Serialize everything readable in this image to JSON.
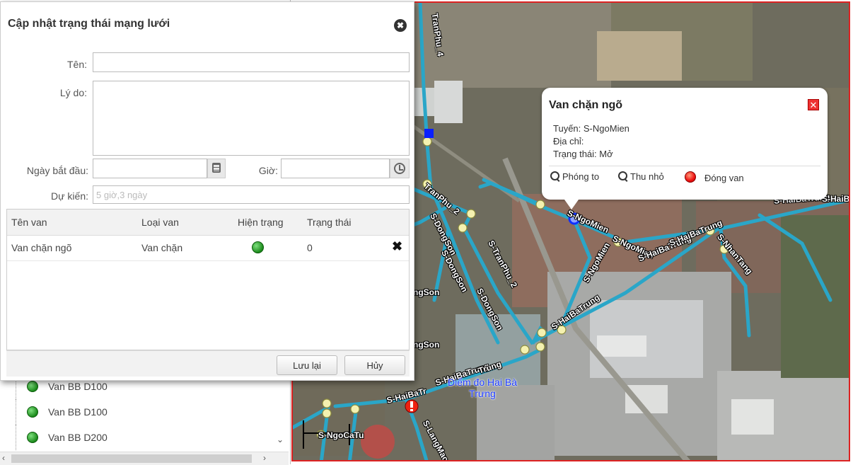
{
  "dialog": {
    "title": "Cập nhật trạng thái mạng lưới",
    "close_symbol": "✖",
    "fields": {
      "name_label": "Tên:",
      "name_value": "",
      "reason_label": "Lý do:",
      "reason_value": "",
      "start_date_label": "Ngày bắt đầu:",
      "start_date_value": "",
      "time_label": "Giờ:",
      "time_value": "",
      "expected_label": "Dự kiến:",
      "expected_placeholder": "5 giờ,3 ngày"
    },
    "table": {
      "headers": [
        "Tên van",
        "Loại van",
        "Hiện trạng",
        "Trạng thái"
      ],
      "rows": [
        {
          "name": "Van chặn ngõ",
          "type": "Van chặn",
          "current_state_icon": "green-dot-icon",
          "status": "0",
          "delete_symbol": "✖"
        }
      ]
    },
    "buttons": {
      "save": "Lưu lại",
      "cancel": "Hủy"
    }
  },
  "left_panel": {
    "valve_list": [
      "Van BB D100",
      "Van BB D100",
      "Van BB D200"
    ],
    "scroll_down": "⌄",
    "scroll_left": "‹",
    "scroll_right": "›"
  },
  "map": {
    "popup": {
      "title": "Van chặn ngõ",
      "close_symbol": "✕",
      "route_label": "Tuyến:",
      "route_value": "S-NgoMien",
      "address_label": "Địa chỉ:",
      "address_value": "",
      "status_label": "Trạng thái:",
      "status_value": "Mở",
      "zoom_in": "Phóng to",
      "zoom_out": "Thu nhỏ",
      "close_valve": "Đóng van"
    },
    "place_label": "Điểm đo Hai Bà Trưng",
    "road_labels": [
      "TranPhu_4",
      "TranPhu_2",
      "S-DongSon",
      "S-DongSon",
      "S-DongSon",
      "S-TranPhu_2",
      "S-NgoMien",
      "S-NgoMien",
      "S-NgoMien",
      "S-HaiBaTrung",
      "S-HaiBaTrung",
      "S-NhanTang",
      "S-HaiBaTrung",
      "S-HaiBa",
      "ngSon",
      "ngSon",
      "S-HaiBaTrung",
      "S-HaiBaTr",
      "S-LangMac",
      "S-NgoCaTu",
      "Trung",
      "S-HaiBaTrung"
    ],
    "colors": {
      "pipe": "#2aa6c8",
      "border": "#d22",
      "node_fill": "#f4f1b0"
    }
  }
}
